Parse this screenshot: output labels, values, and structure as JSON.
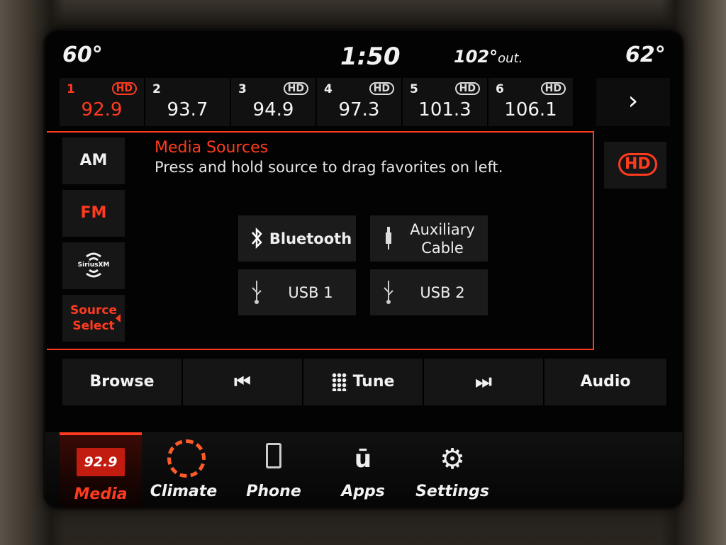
{
  "status": {
    "driver_temp": "60°",
    "clock": "1:50",
    "outside_temp": "102°",
    "outside_label": "out.",
    "passenger_temp": "62°"
  },
  "presets": [
    {
      "num": "1",
      "freq": "92.9",
      "hd": "HD",
      "active": true
    },
    {
      "num": "2",
      "freq": "93.7",
      "hd": "",
      "active": false
    },
    {
      "num": "3",
      "freq": "94.9",
      "hd": "HD",
      "active": false
    },
    {
      "num": "4",
      "freq": "97.3",
      "hd": "HD",
      "active": false
    },
    {
      "num": "5",
      "freq": "101.3",
      "hd": "HD",
      "active": false
    },
    {
      "num": "6",
      "freq": "106.1",
      "hd": "HD",
      "active": false
    }
  ],
  "presets_next": "›",
  "sources": {
    "am": "AM",
    "fm": "FM",
    "sirius": "SiriusXM",
    "source_select": "Source Select"
  },
  "popup": {
    "title": "Media Sources",
    "subtitle": "Press and hold source to drag favorites on left.",
    "bluetooth": "Bluetooth",
    "aux": "Auxiliary Cable",
    "usb1": "USB 1",
    "usb2": "USB 2"
  },
  "hd_button": "HD",
  "controls": {
    "browse": "Browse",
    "prev": "⏮",
    "tune": "Tune",
    "next": "⏭",
    "audio": "Audio"
  },
  "nav": {
    "media_freq": "92.9",
    "media": "Media",
    "climate": "Climate",
    "phone": "Phone",
    "apps": "Apps",
    "settings": "Settings"
  },
  "colors": {
    "accent": "#ff3b1f"
  }
}
